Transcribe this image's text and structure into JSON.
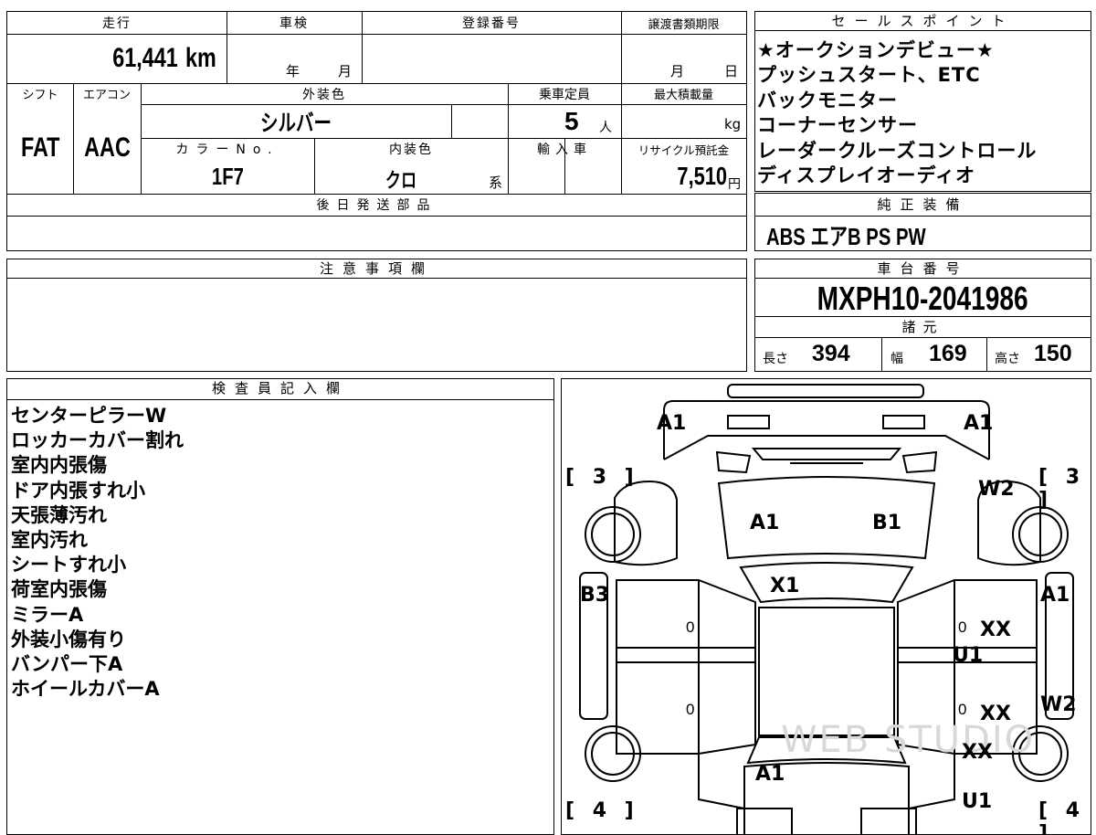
{
  "spec": {
    "mileage_label": "走行",
    "mileage_value": "61,441",
    "mileage_unit": "km",
    "inspection_label": "車検",
    "inspection_year": "年",
    "inspection_month": "月",
    "registration_label": "登録番号",
    "transfer_label": "譲渡書類期限",
    "transfer_month": "月",
    "transfer_day": "日",
    "shift_label": "シフト",
    "ac_label": "エアコン",
    "exterior_label": "外装色",
    "exterior_value": "シルバー",
    "capacity_label": "乗車定員",
    "capacity_value": "5",
    "capacity_unit": "人",
    "maxload_label": "最大積載量",
    "maxload_unit": "kg",
    "shift_value": "FAT",
    "ac_value": "AAC",
    "color_no_label": "カラーNo.",
    "color_no_value": "1F7",
    "interior_label": "内装色",
    "interior_value": "クロ",
    "interior_suffix": "系",
    "import_label": "輸入車",
    "recycle_label": "リサイクル預託金",
    "recycle_value": "7,510",
    "recycle_unit": "円",
    "later_parts_label": "後日発送部品",
    "notes_label": "注意事項欄"
  },
  "sales_points": {
    "label": "セールスポイント",
    "lines": [
      "★オークションデビュー★",
      "プッシュスタート、ETC",
      "バックモニター",
      "コーナーセンサー",
      "レーダークルーズコントロール",
      "ディスプレイオーディオ"
    ]
  },
  "equipment": {
    "label": "純正装備",
    "value": "ABS エアB PS PW"
  },
  "chassis": {
    "label": "車台番号",
    "value": "MXPH10-2041986",
    "dims_label": "諸元",
    "length_label": "長さ",
    "length_value": "394",
    "width_label": "幅",
    "width_value": "169",
    "height_label": "高さ",
    "height_value": "150"
  },
  "inspector": {
    "label": "検査員記入欄",
    "lines": [
      "センターピラーW",
      "ロッカーカバー割れ",
      "室内内張傷",
      "ドア内張すれ小",
      "天張薄汚れ",
      "室内汚れ",
      "シートすれ小",
      "荷室内張傷",
      "ミラーA",
      "外装小傷有り",
      "バンパー下A",
      "ホイールカバーA"
    ]
  },
  "diagram": {
    "front_left": "A1",
    "front_right": "A1",
    "bracket_front_left": "[ 3 ]",
    "bracket_front_right": "[ 3 ]",
    "fender_right": "W2",
    "hood_left": "A1",
    "hood_right": "B1",
    "windshield": "X1",
    "left_front_door": "B3",
    "right_front_door": "A1",
    "right_front_door_mark": "XX",
    "right_pillar": "U1",
    "right_rear_door_mark": "XX",
    "right_rear_panel": "W2",
    "right_quarter": "XX",
    "rear_center": "A1",
    "rear_right": "U1",
    "bracket_rear_left": "[ 4 ]",
    "bracket_rear_right": "[ 4 ]",
    "zero": "0",
    "watermark": "WEB STUDIO"
  }
}
